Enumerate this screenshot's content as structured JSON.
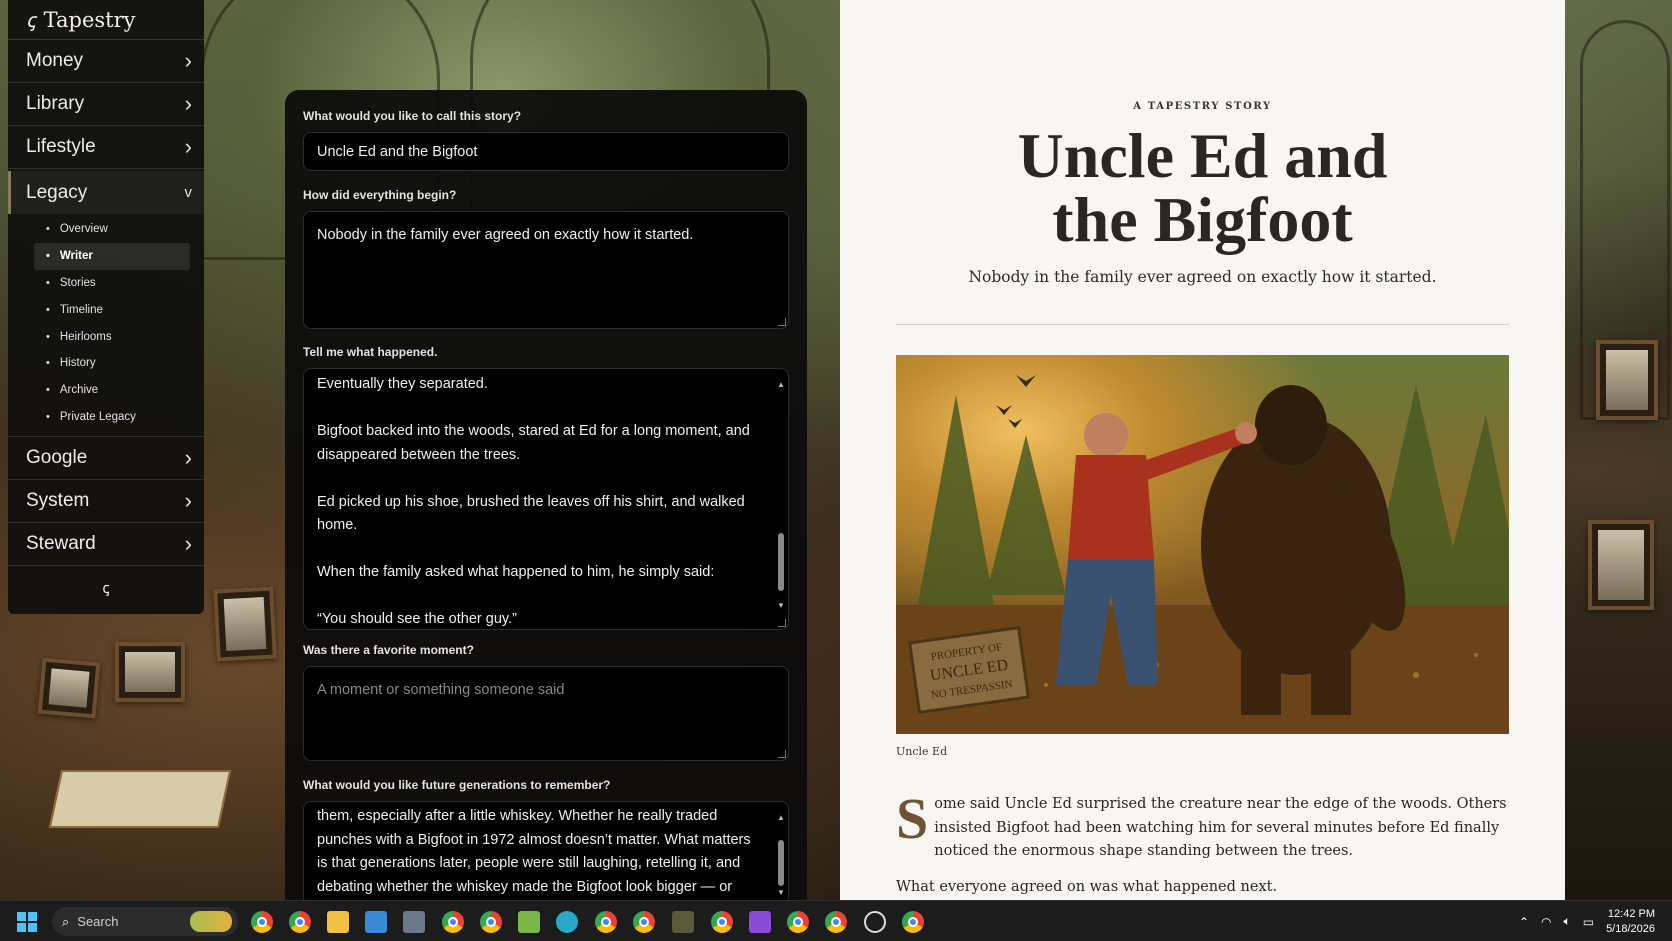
{
  "app": {
    "name": "Tapestry"
  },
  "sidebar": {
    "items": [
      {
        "label": "Money"
      },
      {
        "label": "Library"
      },
      {
        "label": "Lifestyle"
      },
      {
        "label": "Legacy",
        "open": true
      },
      {
        "label": "Google"
      },
      {
        "label": "System"
      },
      {
        "label": "Steward"
      }
    ],
    "legacy_sub": [
      "Overview",
      "Writer",
      "Stories",
      "Timeline",
      "Heirlooms",
      "History",
      "Archive",
      "Private Legacy"
    ],
    "active_sub": "Writer"
  },
  "form": {
    "title_label": "What would you like to call this story?",
    "title_value": "Uncle Ed and the Bigfoot",
    "begin_label": "How did everything begin?",
    "begin_value": "Nobody in the family ever agreed on exactly how it started.",
    "happened_label": "Tell me what happened.",
    "happened_paragraphs": [
      "Eventually they separated.",
      "Bigfoot backed into the woods, stared at Ed for a long moment, and disappeared between the trees.",
      "Ed picked up his shoe, brushed the leaves off his shirt, and walked home.",
      "When the family asked what happened to him, he simply said:",
      "“You should see the other guy.”"
    ],
    "moment_label": "Was there a favorite moment?",
    "moment_placeholder": "A moment or something someone said",
    "remember_label": "What would you like future generations to remember?",
    "remember_value": "them, especially after a little whiskey. Whether he really traded punches with a Bigfoot in 1972 almost doesn’t matter. What matters is that generations later, people were still laughing, retelling it, and debating whether the whiskey made the Bigfoot look bigger — or"
  },
  "story": {
    "kicker": "A TAPESTRY STORY",
    "title_line1": "Uncle Ed and",
    "title_line2": "the Bigfoot",
    "subtitle": "Nobody in the family ever agreed on exactly how it started.",
    "image_sign": [
      "PROPERTY OF",
      "UNCLE ED",
      "NO TRESPASSIN"
    ],
    "caption": "Uncle Ed",
    "dropcap": "S",
    "para1": "ome said Uncle Ed surprised the creature near the edge of the woods. Others insisted Bigfoot had been watching him for several minutes before Ed finally noticed the enormous shape standing between the trees.",
    "para2": "What everyone agreed on was what happened next."
  },
  "taskbar": {
    "search_label": "Search",
    "time": "12:42 PM",
    "date": "5/18/2026"
  }
}
